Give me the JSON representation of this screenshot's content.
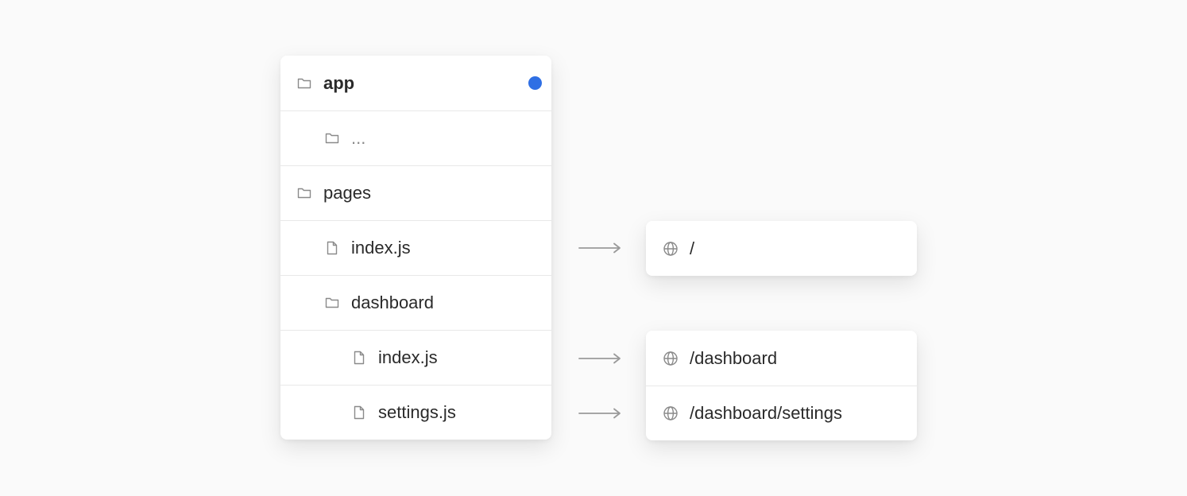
{
  "colors": {
    "accent_dot": "#2f6fe4",
    "arrow": "#9a9a9a",
    "icon": "#8a8a8a"
  },
  "tree": [
    {
      "name": "app",
      "icon": "folder-icon"
    },
    {
      "name": "...",
      "icon": "folder-icon"
    },
    {
      "name": "pages",
      "icon": "folder-icon"
    },
    {
      "name": "index.js",
      "icon": "file-icon"
    },
    {
      "name": "dashboard",
      "icon": "folder-icon"
    },
    {
      "name": "index.js",
      "icon": "file-icon"
    },
    {
      "name": "settings.js",
      "icon": "file-icon"
    }
  ],
  "routes": [
    {
      "path": "/",
      "icon": "globe-icon"
    },
    {
      "path": "/dashboard",
      "icon": "globe-icon"
    },
    {
      "path": "/dashboard/settings",
      "icon": "globe-icon"
    }
  ]
}
